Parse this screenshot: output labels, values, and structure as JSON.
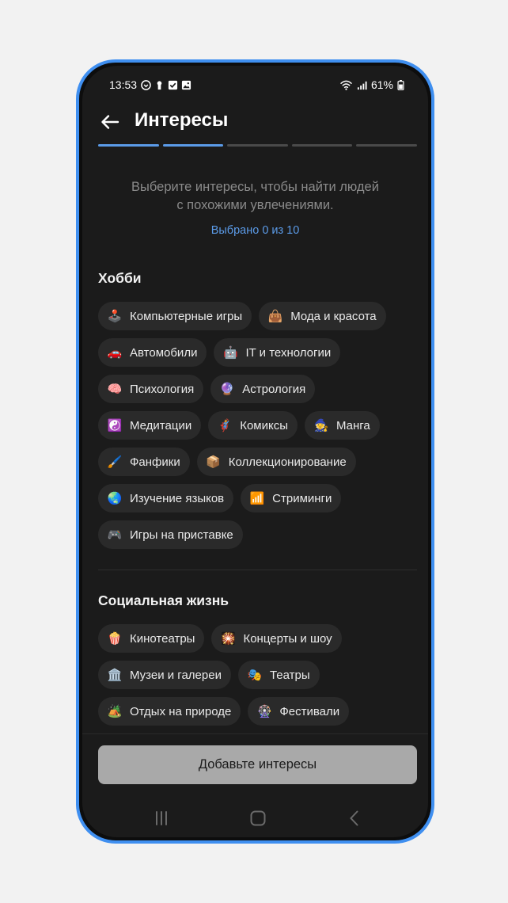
{
  "status_bar": {
    "time": "13:53",
    "battery": "61%",
    "icons_left": [
      "vpn-icon",
      "keyhole-icon",
      "checkbox-icon",
      "image-icon"
    ],
    "icons_right": [
      "wifi-icon",
      "signal-icon",
      "battery-icon"
    ]
  },
  "header": {
    "title": "Интересы"
  },
  "progress": {
    "total_steps": 5,
    "completed_steps": 2
  },
  "intro": {
    "line1": "Выберите интересы, чтобы найти людей",
    "line2": "с похожими увлечениями.",
    "selected_count": "Выбрано 0 из 10"
  },
  "sections": [
    {
      "title": "Хобби",
      "items": [
        {
          "label": "Компьютерные игры",
          "icon": "🕹️",
          "icon_name": "joystick-icon"
        },
        {
          "label": "Мода и красота",
          "icon": "👜",
          "icon_name": "handbag-icon"
        },
        {
          "label": "Автомобили",
          "icon": "🚗",
          "icon_name": "car-icon"
        },
        {
          "label": "IT и технологии",
          "icon": "🤖",
          "icon_name": "robot-icon"
        },
        {
          "label": "Психология",
          "icon": "🧠",
          "icon_name": "brain-icon"
        },
        {
          "label": "Астрология",
          "icon": "🔮",
          "icon_name": "crystal-ball-icon"
        },
        {
          "label": "Медитации",
          "icon": "☯️",
          "icon_name": "yin-yang-icon"
        },
        {
          "label": "Комиксы",
          "icon": "🦸",
          "icon_name": "superhero-icon"
        },
        {
          "label": "Манга",
          "icon": "🧙",
          "icon_name": "witch-icon"
        },
        {
          "label": "Фанфики",
          "icon": "🖌️",
          "icon_name": "paintbrush-icon"
        },
        {
          "label": "Коллекционирование",
          "icon": "📦",
          "icon_name": "box-icon"
        },
        {
          "label": "Изучение языков",
          "icon": "🌏",
          "icon_name": "globe-icon"
        },
        {
          "label": "Стриминги",
          "icon": "📶",
          "icon_name": "wifi-signal-icon"
        },
        {
          "label": "Игры на приставке",
          "icon": "🎮",
          "icon_name": "gamepad-icon"
        }
      ]
    },
    {
      "title": "Социальная жизнь",
      "items": [
        {
          "label": "Кинотеатры",
          "icon": "🍿",
          "icon_name": "popcorn-icon"
        },
        {
          "label": "Концерты и шоу",
          "icon": "🎇",
          "icon_name": "fireworks-icon"
        },
        {
          "label": "Музеи и галереи",
          "icon": "🏛️",
          "icon_name": "museum-icon"
        },
        {
          "label": "Театры",
          "icon": "🎭",
          "icon_name": "theater-masks-icon"
        },
        {
          "label": "Отдых на природе",
          "icon": "🏕️",
          "icon_name": "camping-icon"
        },
        {
          "label": "Фестивали",
          "icon": "🎡",
          "icon_name": "ferris-wheel-icon"
        }
      ]
    }
  ],
  "footer": {
    "add_button_label": "Добавьте интересы"
  },
  "colors": {
    "accent": "#5b9be8",
    "frame": "#3f8ff0",
    "background": "#1b1b1b",
    "chip": "#2a2a2a",
    "button_disabled": "#a9a9a9"
  }
}
